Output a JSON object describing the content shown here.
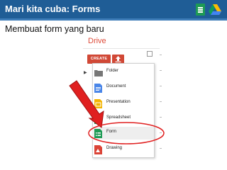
{
  "slide": {
    "title": "Mari kita cuba: Forms",
    "subtitle": "Membuat form yang baru"
  },
  "drive": {
    "label": "Drive",
    "create_label": "CREATE",
    "upload_icon": "upload-icon",
    "menu": [
      {
        "label": "Folder",
        "icon": "folder-icon"
      },
      {
        "label": "Document",
        "icon": "document-icon"
      },
      {
        "label": "Presentation",
        "icon": "presentation-icon"
      },
      {
        "label": "Spreadsheet",
        "icon": "spreadsheet-icon"
      },
      {
        "label": "Form",
        "icon": "form-icon",
        "highlighted": true
      },
      {
        "label": "Drawing",
        "icon": "drawing-icon"
      }
    ]
  },
  "colors": {
    "title_bar": "#1f5d96",
    "create_button": "#d14836",
    "drive_label": "#dd4b39",
    "annotation": "#e02020"
  },
  "annotations": {
    "arrow": "red-arrow",
    "circle": "red-circle"
  }
}
